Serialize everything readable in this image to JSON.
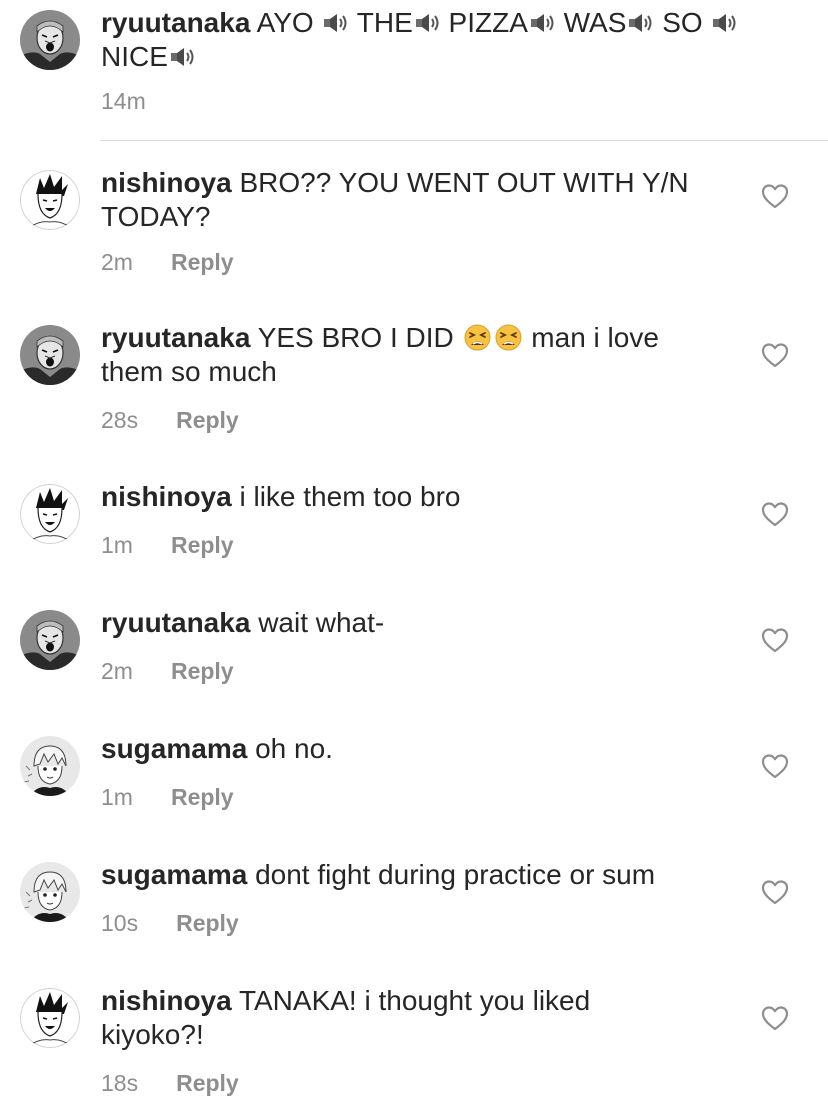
{
  "comments": [
    {
      "username": "ryuutanaka",
      "text_parts": [
        "AYO",
        "THE",
        "PIZZA",
        "WAS",
        "SO",
        "NICE"
      ],
      "time": "14m",
      "reply": "",
      "avatar": "tanaka-avatar"
    },
    {
      "username": "nishinoya",
      "text": "BRO?? YOU WENT OUT WITH Y/N TODAY?",
      "time": "2m",
      "reply": "Reply",
      "avatar": "nishinoya-avatar"
    },
    {
      "username": "ryuutanaka",
      "text_before": "YES BRO I DID",
      "text_after": "man i love them so much",
      "emoji": "tired-face-emoji",
      "time": "28s",
      "reply": "Reply",
      "avatar": "tanaka-avatar"
    },
    {
      "username": "nishinoya",
      "text": "i like them too bro",
      "time": "1m",
      "reply": "Reply",
      "avatar": "nishinoya-avatar"
    },
    {
      "username": "ryuutanaka",
      "text": "wait what-",
      "time": "2m",
      "reply": "Reply",
      "avatar": "tanaka-avatar"
    },
    {
      "username": "sugamama",
      "text": "oh no.",
      "time": "1m",
      "reply": "Reply",
      "avatar": "sugawara-avatar"
    },
    {
      "username": "sugamama",
      "text": "dont fight during practice or sum",
      "time": "10s",
      "reply": "Reply",
      "avatar": "sugawara-avatar"
    },
    {
      "username": "nishinoya",
      "text": "TANAKA! i thought you liked kiyoko?!",
      "time": "18s",
      "reply": "Reply",
      "avatar": "nishinoya-avatar"
    }
  ],
  "icons": {
    "like": "heart-outline-icon",
    "speaker": "speaker-emoji"
  },
  "colors": {
    "text": "#262626",
    "meta": "#8e8e8e",
    "divider": "#dbdbdb"
  }
}
